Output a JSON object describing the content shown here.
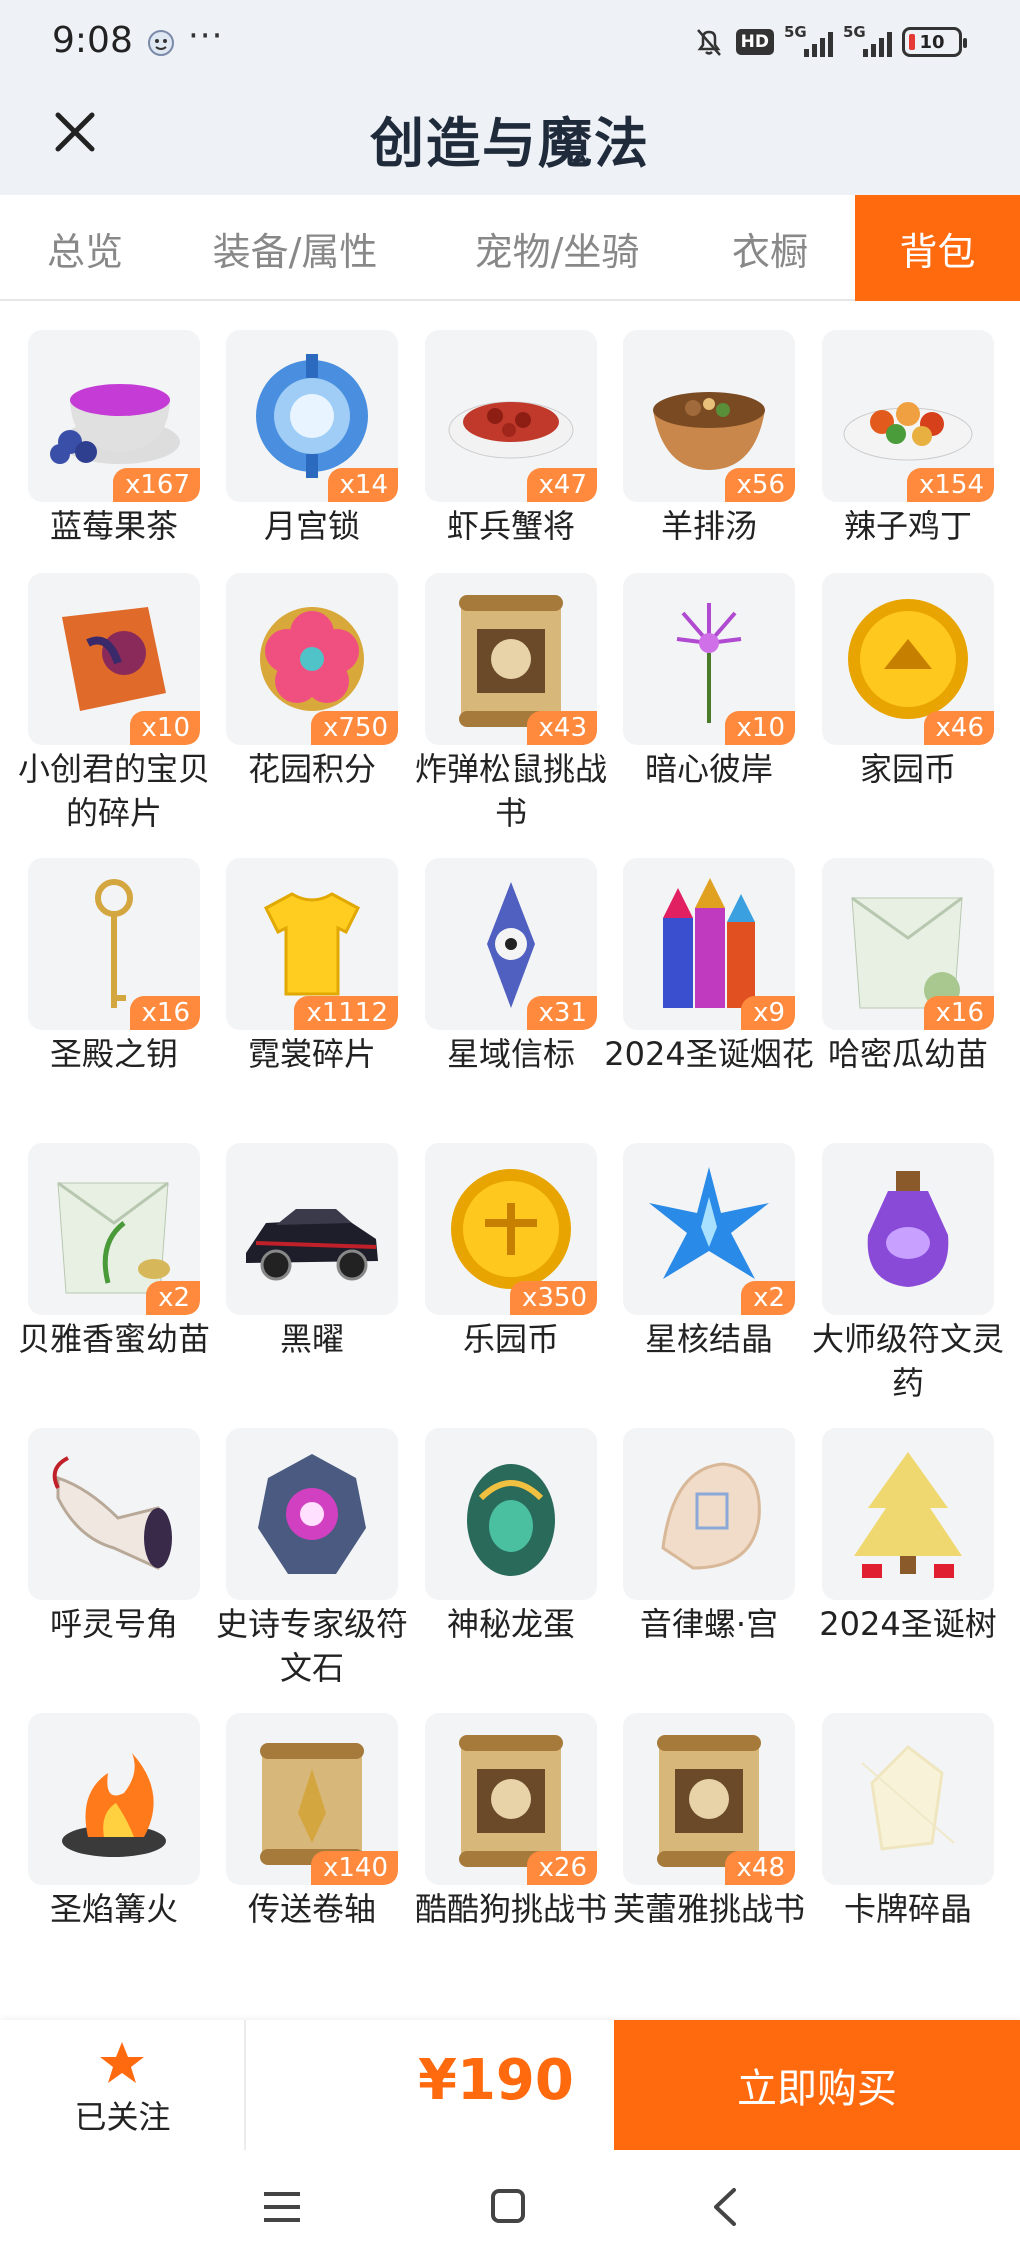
{
  "status": {
    "time": "9:08",
    "dots": "···",
    "hd": "HD",
    "sig1": "5G",
    "sig2": "5G",
    "battery": "10"
  },
  "header": {
    "title": "创造与魔法"
  },
  "tabs": [
    {
      "label": "总览",
      "active": false
    },
    {
      "label": "装备/属性",
      "active": false
    },
    {
      "label": "宠物/坐骑",
      "active": false
    },
    {
      "label": "衣橱",
      "active": false
    },
    {
      "label": "背包",
      "active": true
    }
  ],
  "items": [
    {
      "name": "蓝莓果茶",
      "qty": "x167",
      "icon": "berry-tea-icon"
    },
    {
      "name": "月宫锁",
      "qty": "x14",
      "icon": "moon-lock-icon"
    },
    {
      "name": "虾兵蟹将",
      "qty": "x47",
      "icon": "shrimp-dish-icon"
    },
    {
      "name": "羊排汤",
      "qty": "x56",
      "icon": "lamb-soup-icon"
    },
    {
      "name": "辣子鸡丁",
      "qty": "x154",
      "icon": "spicy-chicken-icon"
    },
    {
      "name": "小创君的宝贝的碎片",
      "qty": "x10",
      "icon": "puzzle-piece-icon"
    },
    {
      "name": "花园积分",
      "qty": "x750",
      "icon": "flower-token-icon"
    },
    {
      "name": "炸弹松鼠挑战书",
      "qty": "x43",
      "icon": "wanted-scroll-icon"
    },
    {
      "name": "暗心彼岸",
      "qty": "x10",
      "icon": "spider-lily-icon"
    },
    {
      "name": "家园币",
      "qty": "x46",
      "icon": "home-coin-icon"
    },
    {
      "name": "圣殿之钥",
      "qty": "x16",
      "icon": "temple-key-icon"
    },
    {
      "name": "霓裳碎片",
      "qty": "x1112",
      "icon": "shirt-fragment-icon"
    },
    {
      "name": "星域信标",
      "qty": "x31",
      "icon": "star-beacon-icon"
    },
    {
      "name": "2024圣诞烟花",
      "qty": "x9",
      "icon": "firework-icon"
    },
    {
      "name": "哈密瓜幼苗",
      "qty": "x16",
      "icon": "melon-seed-pack-icon"
    },
    {
      "name": "贝雅香蜜幼苗",
      "qty": "x2",
      "icon": "seed-pack-icon"
    },
    {
      "name": "黑曜",
      "qty": "",
      "icon": "black-car-icon"
    },
    {
      "name": "乐园币",
      "qty": "x350",
      "icon": "park-coin-icon"
    },
    {
      "name": "星核结晶",
      "qty": "x2",
      "icon": "star-crystal-icon"
    },
    {
      "name": "大师级符文灵药",
      "qty": "",
      "icon": "potion-bottle-icon"
    },
    {
      "name": "呼灵号角",
      "qty": "",
      "icon": "horn-icon"
    },
    {
      "name": "史诗专家级符文石",
      "qty": "",
      "icon": "rune-stone-icon"
    },
    {
      "name": "神秘龙蛋",
      "qty": "",
      "icon": "dragon-egg-icon"
    },
    {
      "name": "音律螺·宫",
      "qty": "",
      "icon": "conch-shell-icon"
    },
    {
      "name": "2024圣诞树",
      "qty": "",
      "icon": "christmas-tree-icon"
    },
    {
      "name": "圣焰篝火",
      "qty": "",
      "icon": "bonfire-icon"
    },
    {
      "name": "传送卷轴",
      "qty": "x140",
      "icon": "teleport-scroll-icon"
    },
    {
      "name": "酷酷狗挑战书",
      "qty": "x26",
      "icon": "wanted-scroll-icon"
    },
    {
      "name": "芙蕾雅挑战书",
      "qty": "x48",
      "icon": "wanted-scroll-icon"
    },
    {
      "name": "卡牌碎晶",
      "qty": "",
      "icon": "card-shard-icon"
    }
  ],
  "bottom": {
    "follow_label": "已关注",
    "price": "¥190",
    "buy_label": "立即购买"
  },
  "colors": {
    "accent": "#ff6a0f",
    "qty_badge": "#ff8a3d",
    "header_bg": "#eef2f7"
  }
}
